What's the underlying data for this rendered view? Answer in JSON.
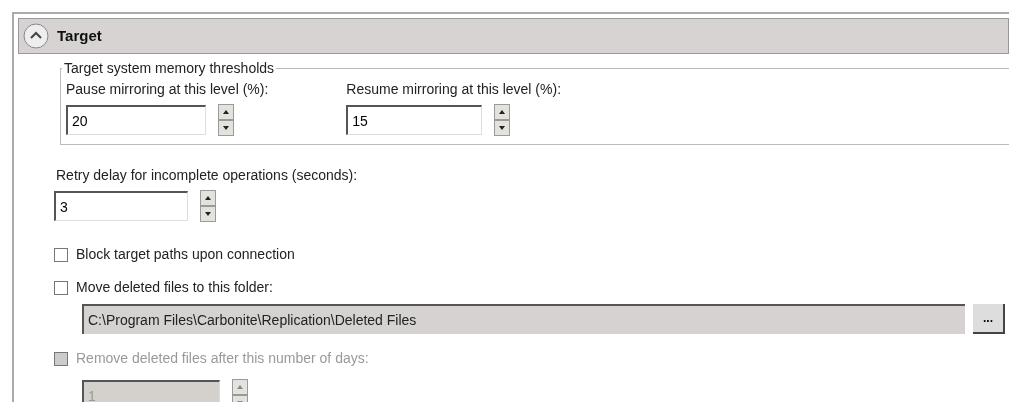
{
  "section": {
    "title": "Target",
    "expanded": true
  },
  "group": {
    "legend": "Target system memory thresholds",
    "fields": [
      {
        "label": "Pause mirroring at this level (%):",
        "value": "20"
      },
      {
        "label": "Resume mirroring at this level (%):",
        "value": "15"
      }
    ]
  },
  "items": [
    {
      "kind": "spinner",
      "label": "Retry delay for incomplete operations (seconds):",
      "value": "3",
      "disabled": false
    },
    {
      "kind": "checkbox",
      "label": "Block target paths upon connection",
      "checked": false,
      "disabled": false
    },
    {
      "kind": "checkbox",
      "label": "Move deleted files to this folder:",
      "checked": false,
      "disabled": false
    },
    {
      "kind": "path",
      "value": "C:\\Program Files\\Carbonite\\Replication\\Deleted Files",
      "button": "...",
      "disabled": true
    },
    {
      "kind": "checkbox",
      "label": "Remove deleted files after this number of days:",
      "checked": false,
      "disabled": true
    },
    {
      "kind": "spinner",
      "value": "1",
      "disabled": true
    }
  ]
}
